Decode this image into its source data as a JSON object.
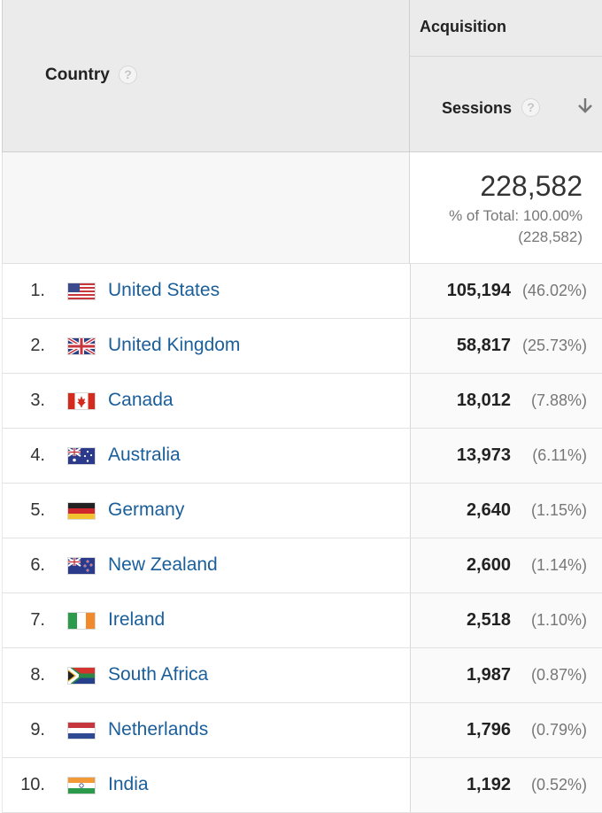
{
  "header": {
    "country_label": "Country",
    "group_label": "Acquisition",
    "sessions_label": "Sessions",
    "help_glyph": "?",
    "sort": "descending"
  },
  "totals": {
    "value": "228,582",
    "pct_label": "% of Total: 100.00%",
    "abs_label": "(228,582)"
  },
  "colors": {
    "link": "#1a5e9a",
    "header_bg": "#ebebeb"
  },
  "rows": [
    {
      "rank": "1.",
      "country": "United States",
      "flag": "us-flag-icon",
      "sessions": "105,194",
      "pct": "(46.02%)"
    },
    {
      "rank": "2.",
      "country": "United Kingdom",
      "flag": "uk-flag-icon",
      "sessions": "58,817",
      "pct": "(25.73%)"
    },
    {
      "rank": "3.",
      "country": "Canada",
      "flag": "canada-flag-icon",
      "sessions": "18,012",
      "pct": "(7.88%)"
    },
    {
      "rank": "4.",
      "country": "Australia",
      "flag": "australia-flag-icon",
      "sessions": "13,973",
      "pct": "(6.11%)"
    },
    {
      "rank": "5.",
      "country": "Germany",
      "flag": "germany-flag-icon",
      "sessions": "2,640",
      "pct": "(1.15%)"
    },
    {
      "rank": "6.",
      "country": "New Zealand",
      "flag": "new-zealand-flag-icon",
      "sessions": "2,600",
      "pct": "(1.14%)"
    },
    {
      "rank": "7.",
      "country": "Ireland",
      "flag": "ireland-flag-icon",
      "sessions": "2,518",
      "pct": "(1.10%)"
    },
    {
      "rank": "8.",
      "country": "South Africa",
      "flag": "south-africa-flag-icon",
      "sessions": "1,987",
      "pct": "(0.87%)"
    },
    {
      "rank": "9.",
      "country": "Netherlands",
      "flag": "netherlands-flag-icon",
      "sessions": "1,796",
      "pct": "(0.79%)"
    },
    {
      "rank": "10.",
      "country": "India",
      "flag": "india-flag-icon",
      "sessions": "1,192",
      "pct": "(0.52%)"
    }
  ]
}
